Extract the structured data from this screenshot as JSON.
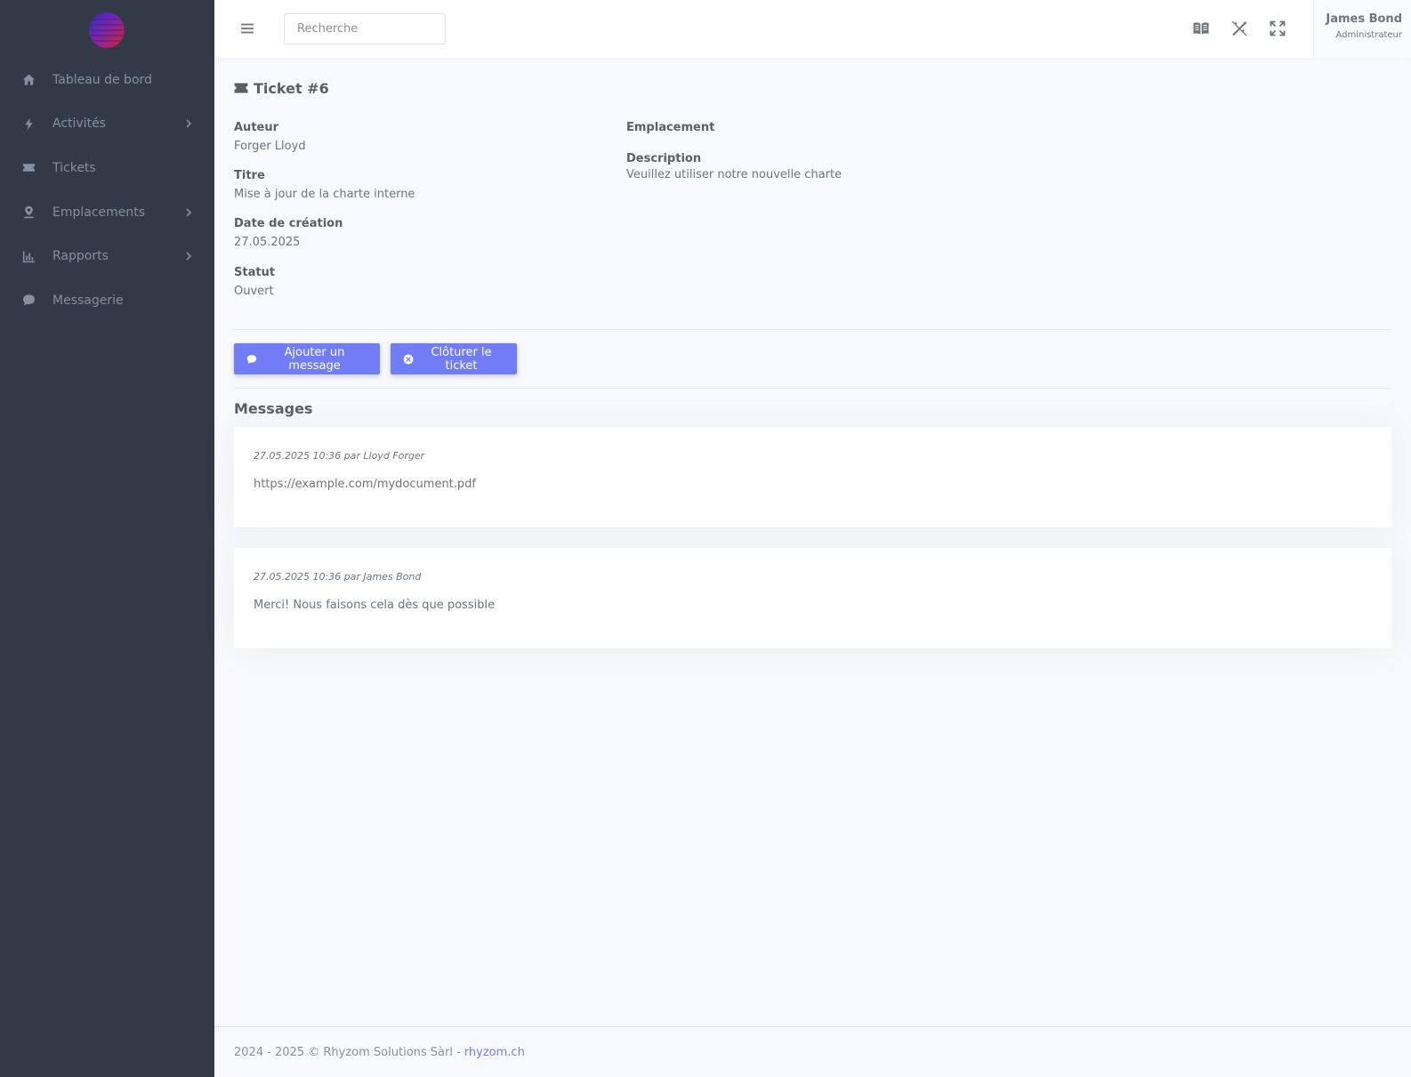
{
  "sidebar": {
    "logo": "rhyzom-logo",
    "items": [
      {
        "label": "Tableau de bord",
        "icon": "home-icon",
        "has_children": false
      },
      {
        "label": "Activités",
        "icon": "bolt-icon",
        "has_children": true
      },
      {
        "label": "Tickets",
        "icon": "ticket-icon",
        "has_children": false
      },
      {
        "label": "Emplacements",
        "icon": "location-pin-icon",
        "has_children": true
      },
      {
        "label": "Rapports",
        "icon": "bar-chart-icon",
        "has_children": true
      },
      {
        "label": "Messagerie",
        "icon": "chat-bubble-icon",
        "has_children": false
      }
    ]
  },
  "topbar": {
    "search_placeholder": "Recherche",
    "icons": [
      "book-icon",
      "magic-wand-icon",
      "fullscreen-icon"
    ],
    "user": {
      "name": "James Bond",
      "role": "Administrateur"
    }
  },
  "ticket": {
    "title": "Ticket #6",
    "fields": {
      "author_label": "Auteur",
      "author_value": "Forger Lloyd",
      "title_label": "Titre",
      "title_value": "Mise à jour de la charte interne",
      "date_label": "Date de création",
      "date_value": "27.05.2025",
      "status_label": "Statut",
      "status_value": "Ouvert",
      "location_label": "Emplacement",
      "location_value": "",
      "description_label": "Description",
      "description_value": "Veuillez utiliser notre nouvelle charte"
    },
    "actions": {
      "add_message": "Ajouter un message",
      "close_ticket": "Clôturer le ticket"
    }
  },
  "messages": {
    "title": "Messages",
    "items": [
      {
        "meta": "27.05.2025 10:36 par Lloyd Forger",
        "body": "https://example.com/mydocument.pdf"
      },
      {
        "meta": "27.05.2025 10:36 par James Bond",
        "body": "Merci! Nous faisons cela dès que possible"
      }
    ]
  },
  "footer": {
    "text": "2024 - 2025 © Rhyzom Solutions Sàrl -",
    "link": "rhyzom.ch"
  },
  "colors": {
    "sidebar_bg": "#313a46",
    "primary": "#727cf5",
    "content_bg": "#f8f9fd"
  }
}
